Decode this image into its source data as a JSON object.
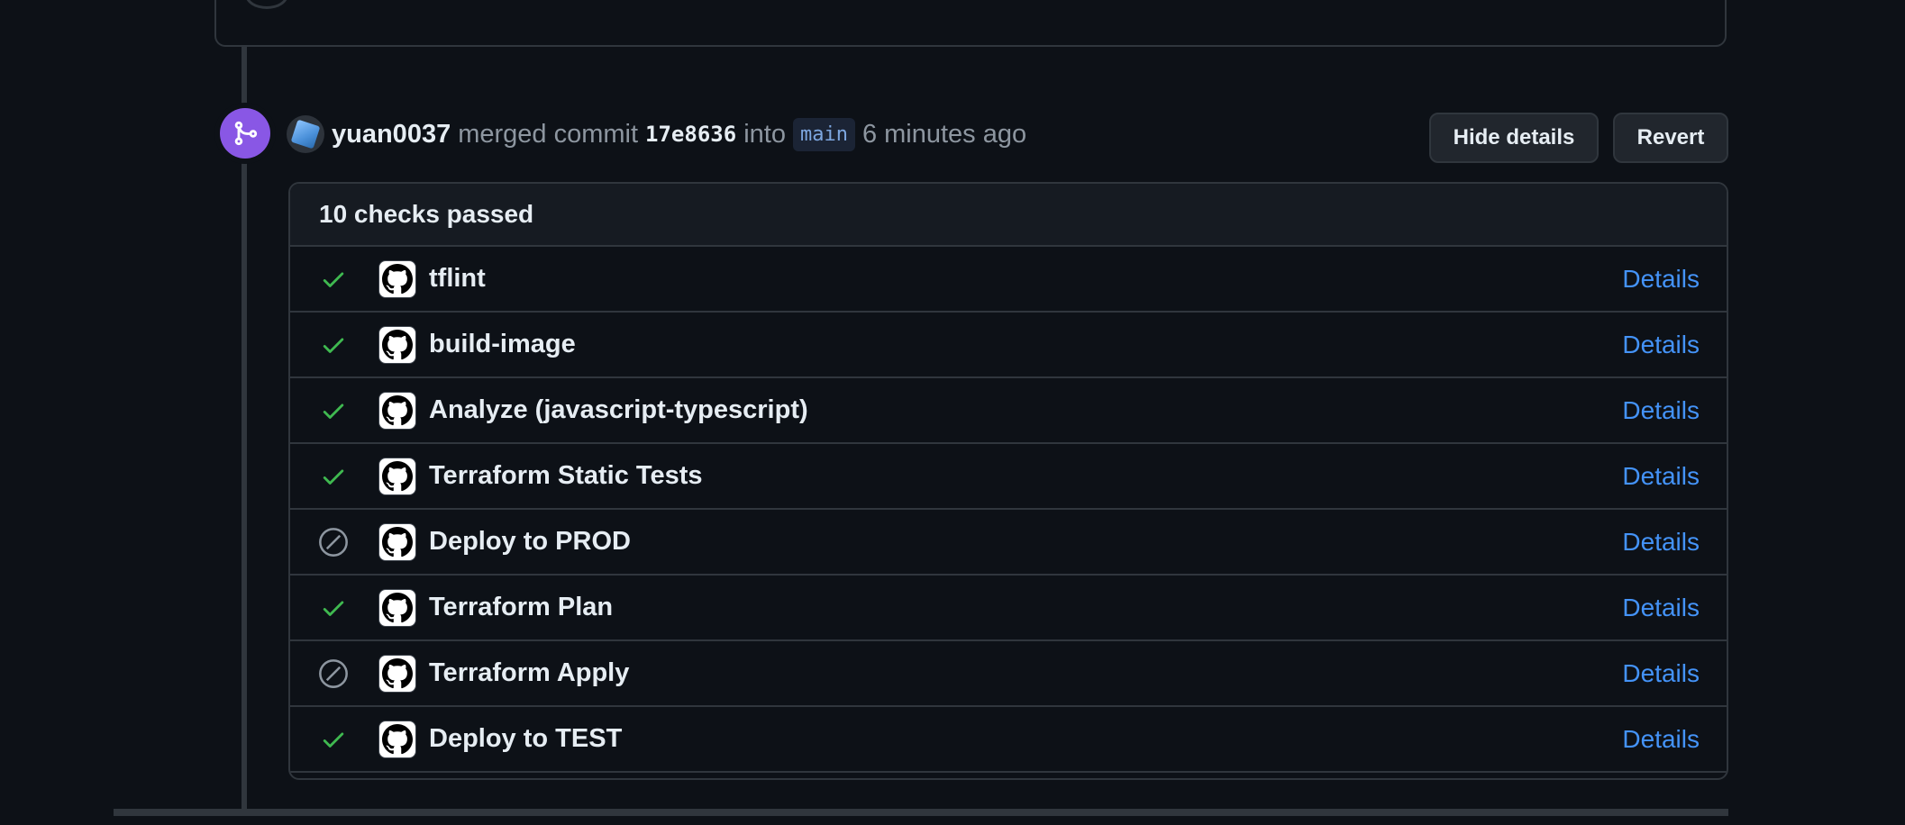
{
  "merge_event": {
    "author": "yuan0037",
    "action_text": "merged commit",
    "commit_sha": "17e8636",
    "into_text": "into",
    "branch": "main",
    "time_ago": "6 minutes ago"
  },
  "buttons": {
    "hide_details": "Hide details",
    "revert": "Revert"
  },
  "checks": {
    "summary": "10 checks passed",
    "details_label": "Details",
    "items": [
      {
        "name": "tflint",
        "status": "success"
      },
      {
        "name": "build-image",
        "status": "success"
      },
      {
        "name": "Analyze (javascript-typescript)",
        "status": "success"
      },
      {
        "name": "Terraform Static Tests",
        "status": "success"
      },
      {
        "name": "Deploy to PROD",
        "status": "skipped"
      },
      {
        "name": "Terraform Plan",
        "status": "success"
      },
      {
        "name": "Terraform Apply",
        "status": "skipped"
      },
      {
        "name": "Deploy to TEST",
        "status": "success"
      }
    ]
  },
  "colors": {
    "background": "#0d1117",
    "merge_badge": "#8957e5",
    "success": "#3fb950",
    "skipped": "#8d96a0",
    "link": "#4493f8"
  },
  "icons": {
    "merge": "git-merge-icon",
    "success": "check-icon",
    "skipped": "skip-icon",
    "app": "github-mark-icon"
  }
}
